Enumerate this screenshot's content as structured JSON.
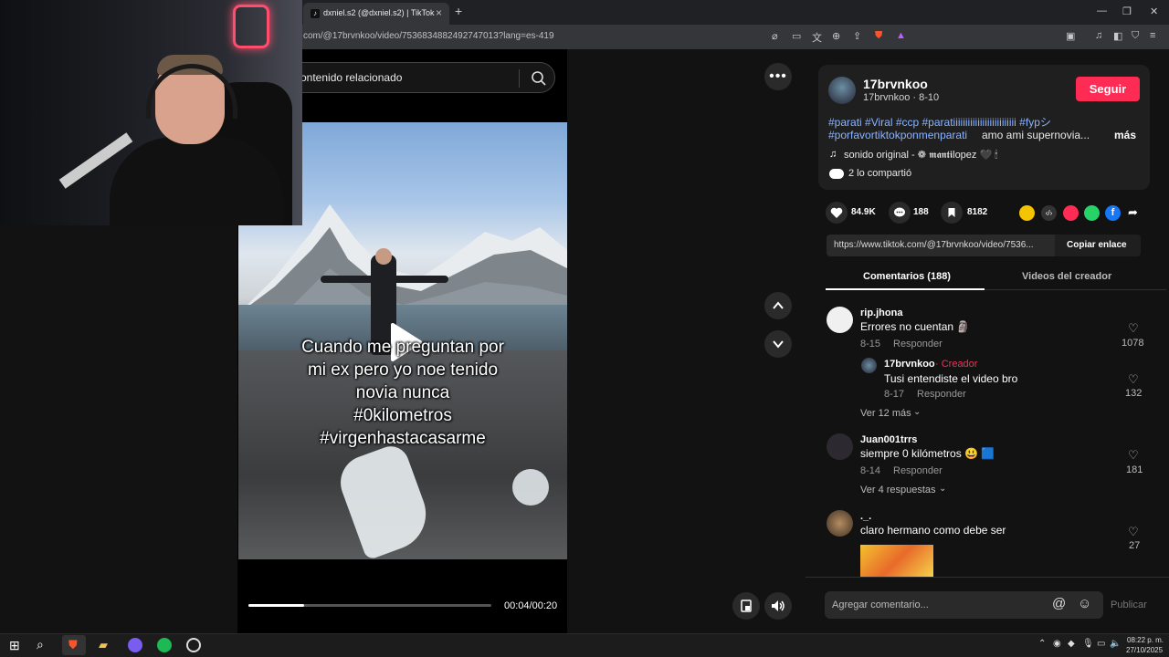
{
  "browser": {
    "tab_title": "dxniel.s2 (@dxniel.s2) | TikTok",
    "url": "com/@17brvnkoo/video/7536834882492747013?lang=es-419"
  },
  "search": {
    "text": "ontenido relacionado"
  },
  "video": {
    "caption": "Cuando me preguntan por\nmi ex pero yo noe tenido\nnovia nunca\n#0kilometros\n#virgenhastacasarme",
    "time": "00:04/00:20",
    "progress": 0.23
  },
  "author": {
    "username": "17brvnkoo",
    "subline": "17brvnkoo · 8-10",
    "follow_label": "Seguir",
    "hashtags_line1": "#parati #Viral #ccp #paratiiiiiiiiiiiiiiiiiiiiiiiiii #fypシ",
    "hashtags_line2": "#porfavortiktokponmenparati",
    "desc_rest": "amo ami supernovia...",
    "more_label": "más",
    "sound": "sonido original - ❁ 𝖒𝖆𝖓𝖙𝖎lopez 🖤 🕯",
    "shared": "2 lo compartió"
  },
  "stats": {
    "likes": "84.9K",
    "comments": "188",
    "saves": "8182"
  },
  "link": {
    "url": "https://www.tiktok.com/@17brvnkoo/video/7536...",
    "copy_label": "Copiar enlace"
  },
  "tabs": {
    "comments": "Comentarios (188)",
    "creator_videos": "Videos del creador"
  },
  "comments": [
    {
      "user": "rip.jhona",
      "text": "Errores no cuentan 🗿",
      "date": "8-15",
      "reply": "Responder",
      "likes": "1078"
    },
    {
      "user": "17brvnkoo",
      "creator_tag": "· Creador",
      "text": "Tusi entendiste el video bro",
      "date": "8-17",
      "reply": "Responder",
      "likes": "132"
    },
    {
      "more": "Ver 12 más"
    },
    {
      "user": "Juan001trrs",
      "text": "siempre 0 kilómetros 😃 🟦",
      "date": "8-14",
      "reply": "Responder",
      "likes": "181"
    },
    {
      "more": "Ver 4 respuestas"
    },
    {
      "user": "._.",
      "text": "claro hermano como debe ser",
      "likes": "27"
    }
  ],
  "compose": {
    "placeholder": "Agregar comentario...",
    "post_label": "Publicar"
  },
  "taskbar": {
    "time": "08:22 p. m.",
    "date": "27/10/2025"
  },
  "colors": {
    "accent": "#fe2c55",
    "creator": "#fe2c55"
  }
}
